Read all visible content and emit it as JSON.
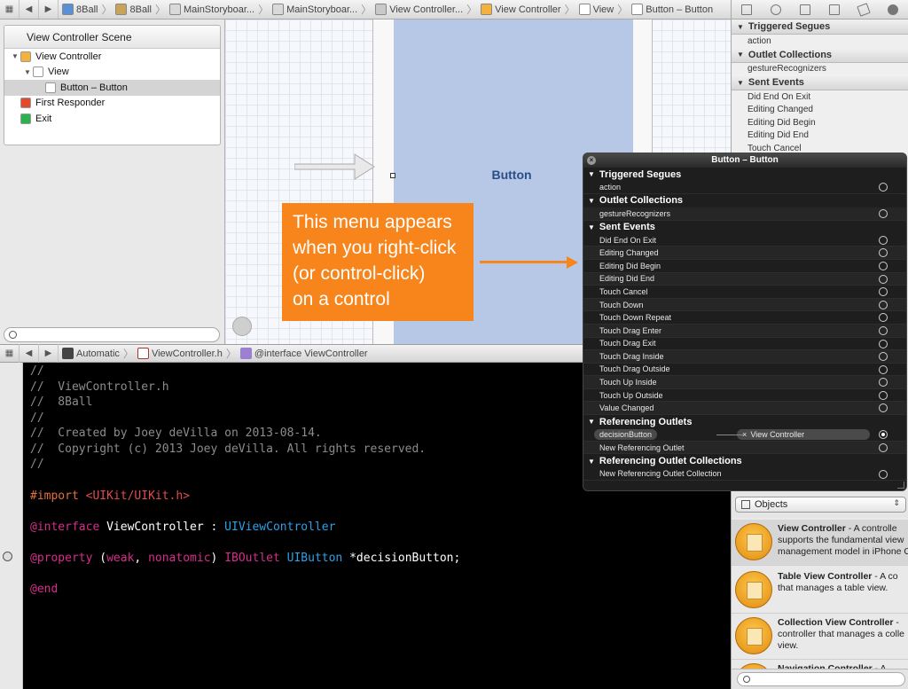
{
  "breadcrumbs": [
    {
      "label": "8Ball",
      "icon": "project-icon"
    },
    {
      "label": "8Ball",
      "icon": "folder-icon"
    },
    {
      "label": "MainStoryboar...",
      "icon": "storyboard-icon"
    },
    {
      "label": "MainStoryboar...",
      "icon": "storyboard-icon"
    },
    {
      "label": "View Controller...",
      "icon": "scene-icon"
    },
    {
      "label": "View Controller",
      "icon": "view-controller-icon"
    },
    {
      "label": "View",
      "icon": "view-icon"
    },
    {
      "label": "Button – Button",
      "icon": "button-icon"
    }
  ],
  "outline": {
    "scene_title": "View Controller Scene",
    "items": [
      {
        "label": "View Controller",
        "indent": 0,
        "expanded": true,
        "icon": "view-controller-icon",
        "color": "#f4b23d"
      },
      {
        "label": "View",
        "indent": 1,
        "expanded": true,
        "icon": "view-icon",
        "color": "#ffffff"
      },
      {
        "label": "Button – Button",
        "indent": 2,
        "expanded": false,
        "icon": "button-icon",
        "color": "#ffffff",
        "selected": true
      },
      {
        "label": "First Responder",
        "indent": 0,
        "expanded": false,
        "icon": "first-responder-icon",
        "color": "#e24b2a"
      },
      {
        "label": "Exit",
        "indent": 0,
        "expanded": false,
        "icon": "exit-icon",
        "color": "#2bb24a"
      }
    ]
  },
  "canvas": {
    "button_label": "Button"
  },
  "callout": {
    "lines": [
      "This menu appears",
      "when you right-click",
      "(or control-click)",
      "on a control"
    ]
  },
  "jumpbar2": {
    "automatic": "Automatic",
    "file": "ViewController.h",
    "symbol": "@interface ViewController"
  },
  "code": {
    "comment_lines": [
      "//",
      "//  ViewController.h",
      "//  8Ball",
      "//",
      "//  Created by Joey deVilla on 2013-08-14.",
      "//  Copyright (c) 2013 Joey deVilla. All rights reserved.",
      "//"
    ],
    "import_kw": "#import",
    "import_path": "<UIKit/UIKit.h>",
    "interface_kw": "@interface",
    "interface_name": "ViewController",
    "interface_colon": " : ",
    "interface_super": "UIViewController",
    "property_kw": "@property",
    "property_open": " (",
    "weak": "weak",
    "comma": ", ",
    "nonatomic": "nonatomic",
    "property_close": ") ",
    "iboutlet": "IBOutlet",
    "uibutton": "UIButton",
    "var": " *decisionButton;",
    "end_kw": "@end"
  },
  "inspector": {
    "sections": [
      {
        "title": "Triggered Segues",
        "rows": [
          "action"
        ]
      },
      {
        "title": "Outlet Collections",
        "rows": [
          "gestureRecognizers"
        ]
      },
      {
        "title": "Sent Events",
        "rows": [
          "Did End On Exit",
          "Editing Changed",
          "Editing Did Begin",
          "Editing Did End",
          "Touch Cancel"
        ]
      }
    ]
  },
  "hud": {
    "title": "Button – Button",
    "close": "×",
    "sections": [
      {
        "title": "Triggered Segues",
        "rows": [
          {
            "label": "action"
          }
        ]
      },
      {
        "title": "Outlet Collections",
        "rows": [
          {
            "label": "gestureRecognizers"
          }
        ]
      },
      {
        "title": "Sent Events",
        "rows": [
          {
            "label": "Did End On Exit"
          },
          {
            "label": "Editing Changed"
          },
          {
            "label": "Editing Did Begin"
          },
          {
            "label": "Editing Did End"
          },
          {
            "label": "Touch Cancel"
          },
          {
            "label": "Touch Down"
          },
          {
            "label": "Touch Down Repeat"
          },
          {
            "label": "Touch Drag Enter"
          },
          {
            "label": "Touch Drag Exit"
          },
          {
            "label": "Touch Drag Inside"
          },
          {
            "label": "Touch Drag Outside"
          },
          {
            "label": "Touch Up Inside"
          },
          {
            "label": "Touch Up Outside"
          },
          {
            "label": "Value Changed"
          }
        ]
      },
      {
        "title": "Referencing Outlets",
        "rows": [
          {
            "label": "decisionButton",
            "connected": true,
            "target_x": "×",
            "target": "View Controller"
          },
          {
            "label": "New Referencing Outlet"
          }
        ]
      },
      {
        "title": "Referencing Outlet Collections",
        "rows": [
          {
            "label": "New Referencing Outlet Collection"
          }
        ]
      }
    ]
  },
  "library": {
    "selector": "Objects",
    "items": [
      {
        "name": "View Controller",
        "desc1": " - A controlle",
        "desc2": "supports the fundamental view",
        "desc3": "management model in iPhone O",
        "selected": true
      },
      {
        "name": "Table View Controller",
        "desc1": " - A co",
        "desc2": "that manages a table view.",
        "desc3": ""
      },
      {
        "name": "Collection View Controller",
        "desc1": " - ",
        "desc2": "controller that manages a colle",
        "desc3": "view."
      },
      {
        "name": "Navigation Controller",
        "desc1": " - A",
        "desc2": "",
        "desc3": ""
      }
    ]
  },
  "colors": {
    "accent": "#f7851c",
    "canvas_view": "#b7c8e6",
    "editor_bg": "#000000"
  }
}
